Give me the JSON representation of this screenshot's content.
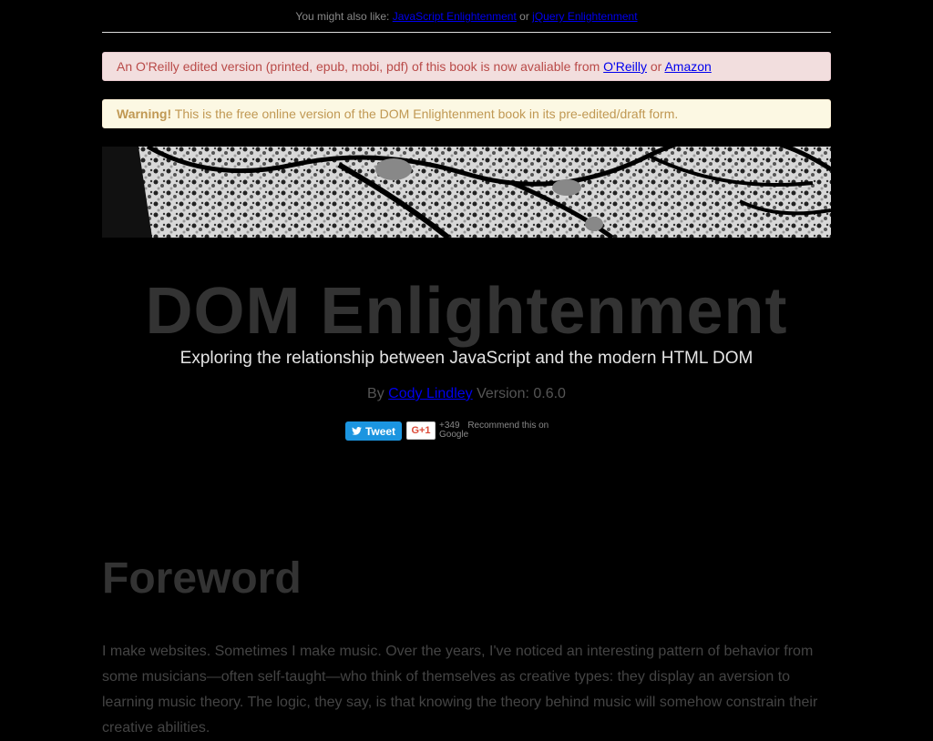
{
  "top_bar": {
    "prefix": "You might also like:",
    "link1": "JavaScript Enlightenment",
    "or": "or",
    "link2": "jQuery Enlightenment"
  },
  "notice_oreilly": {
    "text": "An O'Reilly edited version (printed, epub, mobi, pdf) of this book is now avaliable from",
    "link1": "O'Reilly",
    "or": "or",
    "link2": "Amazon"
  },
  "notice_warning": {
    "strong": "Warning!",
    "text": "This is the free online version of the DOM Enlightenment book in its pre-edited/draft form."
  },
  "header": {
    "title": "DOM Enlightenment",
    "subtitle": "Exploring the relationship between JavaScript and the modern HTML DOM",
    "by": "By",
    "author": "Cody Lindley",
    "version": "Version: 0.6.0"
  },
  "social": {
    "tweet_label": "Tweet",
    "gplus_label": "G+1",
    "gplus_count": "+349",
    "gplus_text": "Recommend this on Google"
  },
  "foreword": {
    "heading": "Foreword",
    "text": "I make websites. Sometimes I make music. Over the years, I've noticed an interesting pattern of behavior from some musicians—often self-taught—who think of themselves as creative types: they display an aversion to learning music theory. The logic, they say, is that knowing the theory behind music will somehow constrain their creative abilities."
  },
  "colors": {
    "background": "#000000",
    "link": "#0000ee",
    "notice_error_bg": "#f2dede",
    "notice_error_text": "#b94a48",
    "notice_warning_bg": "#fcf8e3",
    "notice_warning_text": "#c09853",
    "tweet_blue": "#1b95e0"
  }
}
